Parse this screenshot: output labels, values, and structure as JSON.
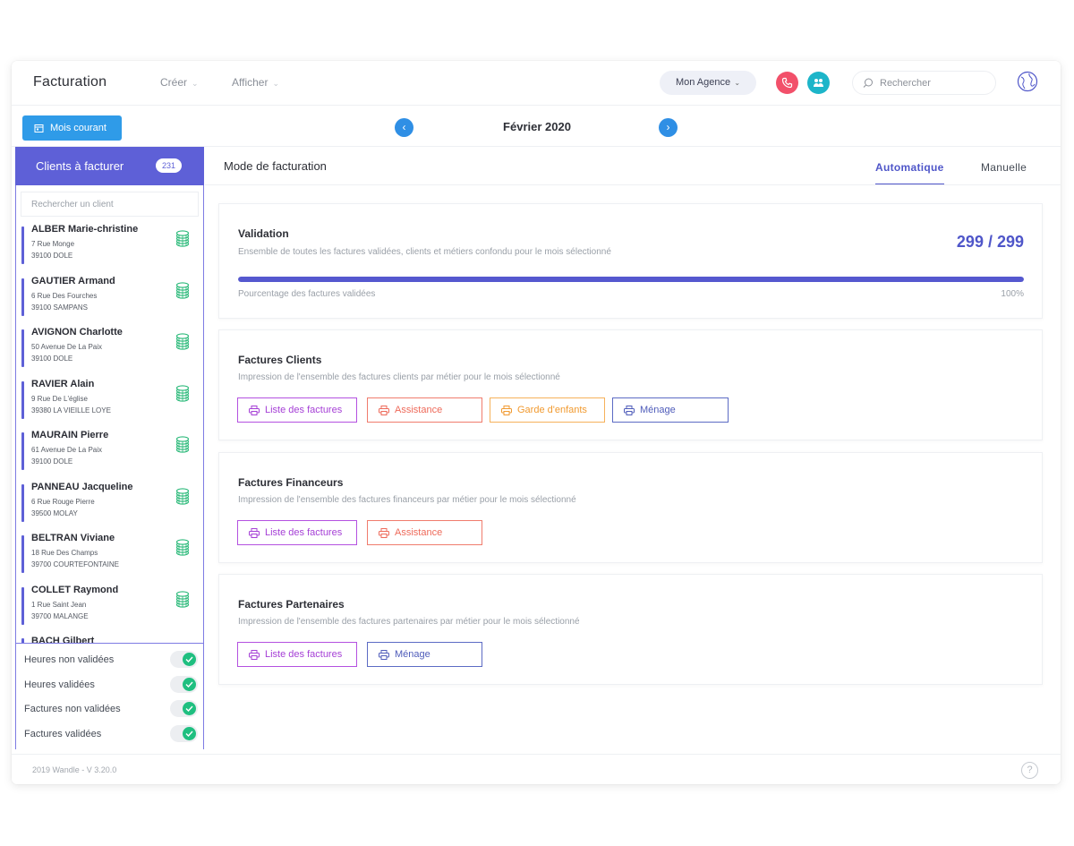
{
  "app": {
    "title": "Facturation",
    "menu_creer": "Créer",
    "menu_afficher": "Afficher",
    "agency": "Mon Agence",
    "search_placeholder": "Rechercher"
  },
  "monthbar": {
    "current_month_button": "Mois courant",
    "month": "Février 2020"
  },
  "sidebar": {
    "title": "Clients à facturer",
    "count": "231",
    "search_placeholder": "Rechercher un client",
    "clients": [
      {
        "name": "ALBER Marie-christine",
        "street": "7 Rue Monge",
        "city": "39100 DOLE"
      },
      {
        "name": "GAUTIER Armand",
        "street": "6 Rue Des Fourches",
        "city": "39100 SAMPANS"
      },
      {
        "name": "AVIGNON Charlotte",
        "street": "50 Avenue De La Paix",
        "city": "39100 DOLE"
      },
      {
        "name": "RAVIER Alain",
        "street": "9 Rue De L'église",
        "city": "39380 LA VIEILLE LOYE"
      },
      {
        "name": "MAURAIN Pierre",
        "street": "61 Avenue De La Paix",
        "city": "39100 DOLE"
      },
      {
        "name": "PANNEAU Jacqueline",
        "street": "6 Rue Rouge Pierre",
        "city": "39500 MOLAY"
      },
      {
        "name": "BELTRAN Viviane",
        "street": "18 Rue Des Champs",
        "city": "39700 COURTEFONTAINE"
      },
      {
        "name": "COLLET Raymond",
        "street": "1 Rue Saint Jean",
        "city": "39700 MALANGE"
      },
      {
        "name": "BACH Gilbert",
        "street": "",
        "city": ""
      }
    ],
    "filters": [
      {
        "label": "Heures non validées",
        "on": true
      },
      {
        "label": "Heures validées",
        "on": true
      },
      {
        "label": "Factures non validées",
        "on": true
      },
      {
        "label": "Factures validées",
        "on": true
      }
    ]
  },
  "main": {
    "mode_title": "Mode de facturation",
    "tabs": [
      {
        "label": "Automatique",
        "active": true
      },
      {
        "label": "Manuelle",
        "active": false
      }
    ],
    "validation": {
      "title": "Validation",
      "description": "Ensemble de toutes les factures validées, clients et métiers confondu pour le mois sélectionné",
      "count": "299 / 299",
      "progress_label": "Pourcentage des factures validées",
      "progress_percent": 100,
      "progress_text": "100%"
    },
    "clients": {
      "title": "Factures Clients",
      "description": "Impression de l'ensemble des factures clients par métier pour le mois sélectionné",
      "buttons": [
        "Liste des factures",
        "Assistance",
        "Garde d'enfants",
        "Ménage"
      ]
    },
    "financeurs": {
      "title": "Factures Financeurs",
      "description": "Impression de l'ensemble des factures financeurs par métier pour le mois sélectionné",
      "buttons": [
        "Liste des factures",
        "Assistance"
      ]
    },
    "partenaires": {
      "title": "Factures Partenaires",
      "description": "Impression de l'ensemble des factures partenaires par métier pour le mois sélectionné",
      "buttons": [
        "Liste des factures",
        "Ménage"
      ]
    }
  },
  "footer": {
    "version": "2019 Wandle - V 3.20.0",
    "help": "?"
  },
  "colors": {
    "accent": "#5e60d7",
    "primary_blue": "#2f9be8",
    "purple": "#b451e0",
    "red": "#f07c6d",
    "orange": "#f6b15b",
    "navy": "#5c6bc4",
    "success": "#1fbf80"
  },
  "icons": {
    "phone": "phone-icon",
    "team": "team-icon",
    "search": "search-icon",
    "globe": "globe-icon",
    "calendar": "calendar-icon",
    "coins": "coins-stack-icon",
    "printer": "printer-icon",
    "check": "check-icon",
    "help": "help-icon"
  }
}
